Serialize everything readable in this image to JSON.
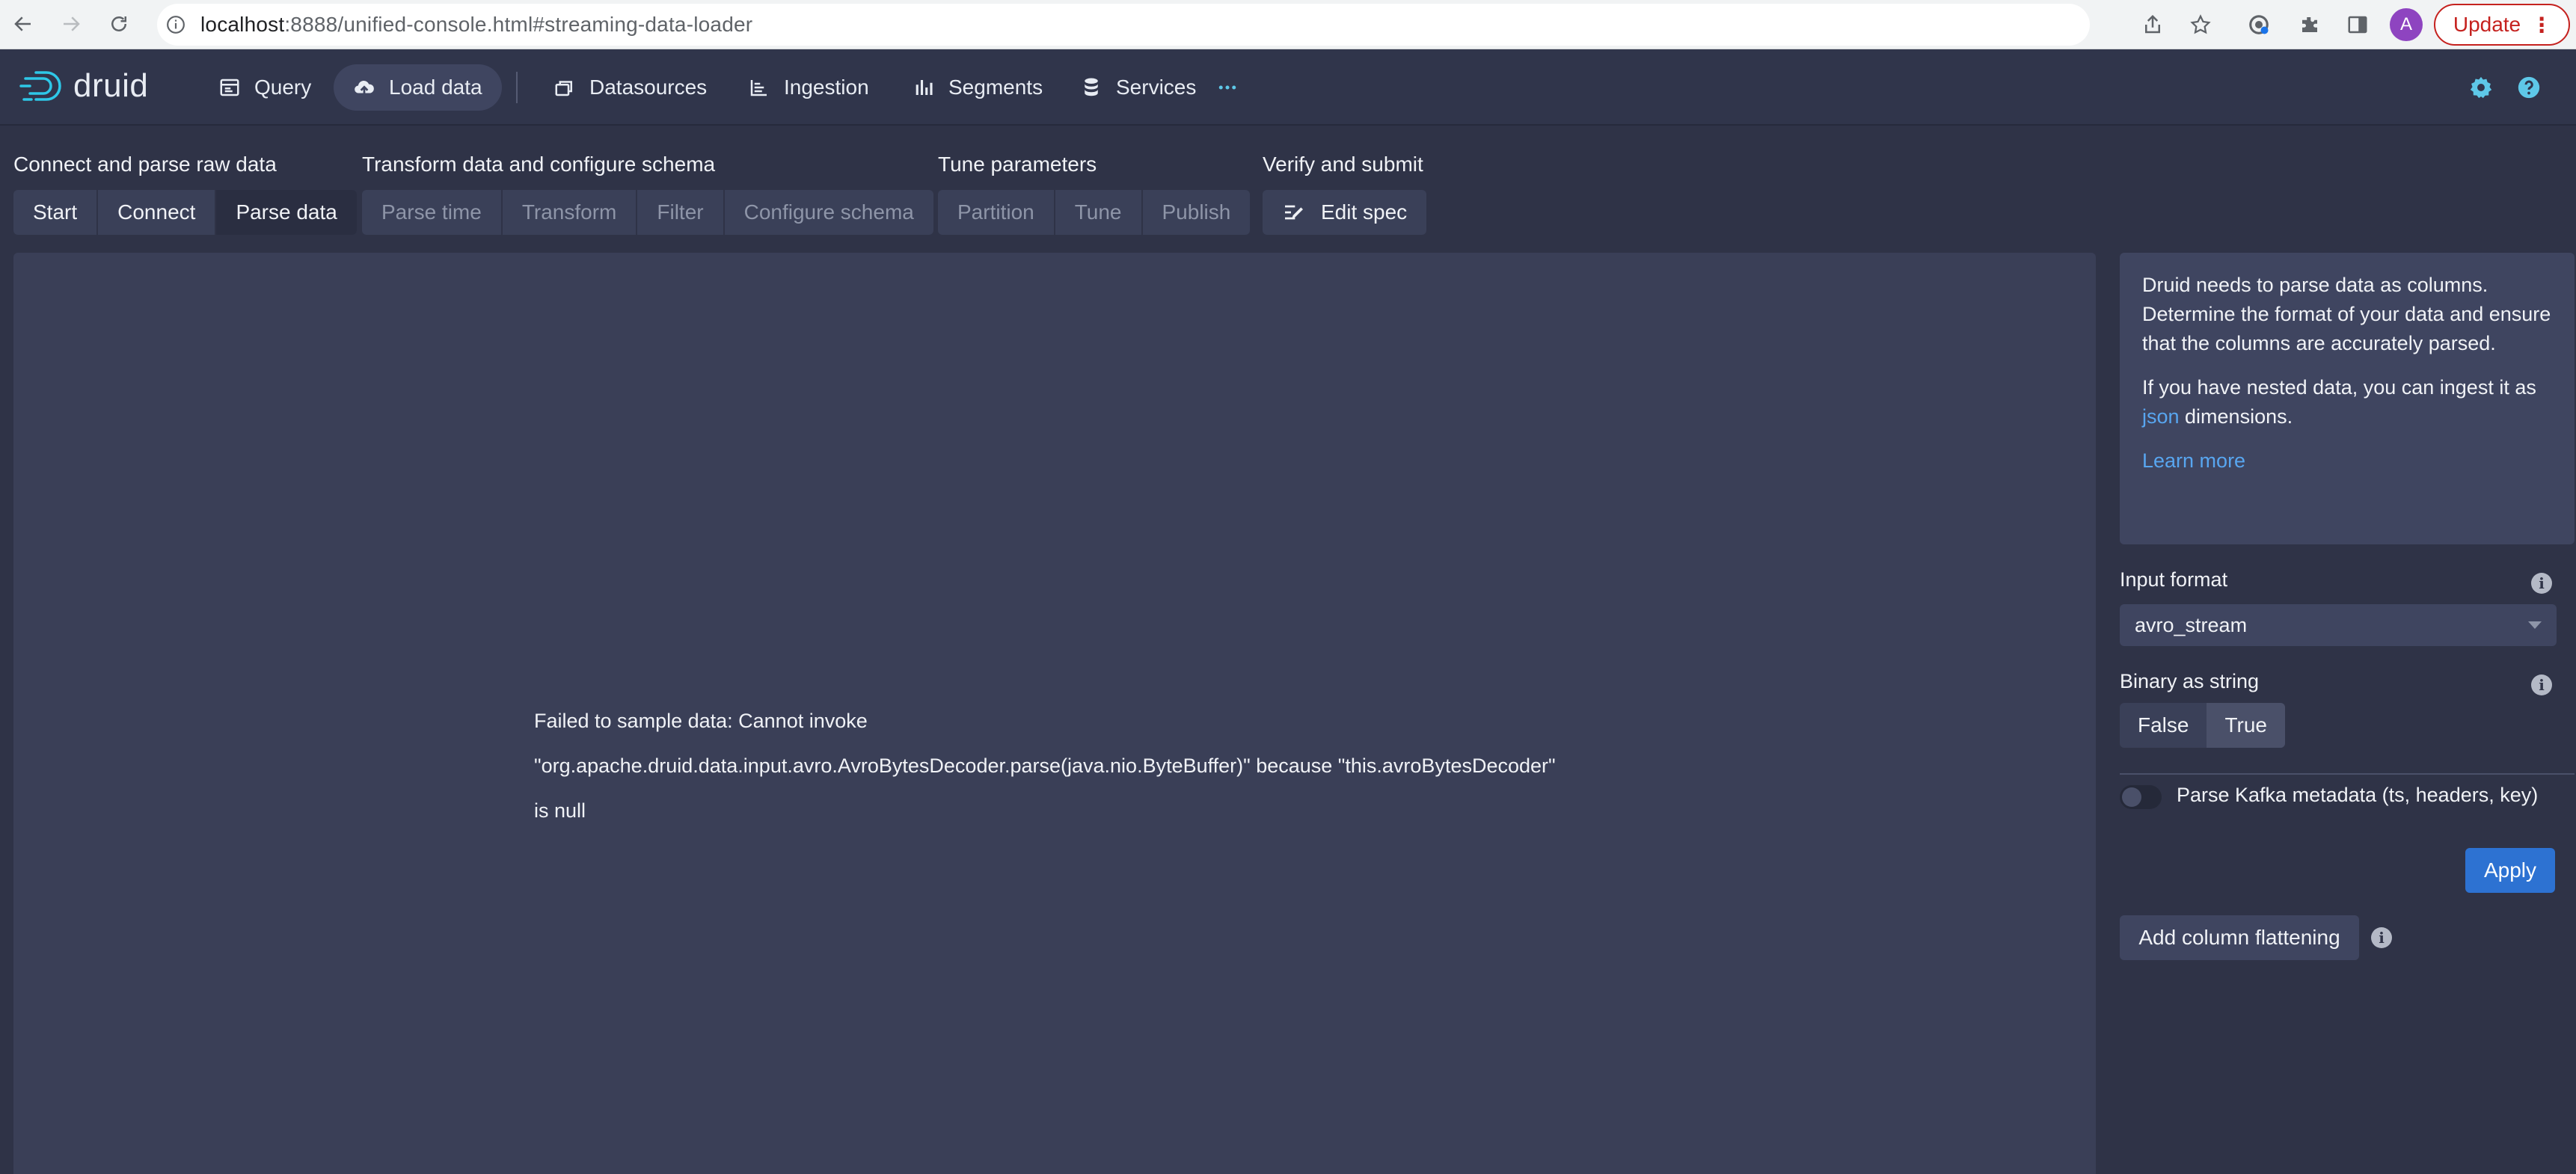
{
  "browser": {
    "url_host": "localhost",
    "url_rest": ":8888/unified-console.html#streaming-data-loader",
    "profile_initial": "A",
    "update_label": "Update"
  },
  "header": {
    "logo_text": "druid",
    "nav": [
      {
        "label": "Query",
        "icon": "query-icon"
      },
      {
        "label": "Load data",
        "icon": "cloud-upload-icon"
      },
      {
        "label": "Datasources",
        "icon": "datasources-icon"
      },
      {
        "label": "Ingestion",
        "icon": "ingestion-icon"
      },
      {
        "label": "Segments",
        "icon": "segments-icon"
      },
      {
        "label": "Services",
        "icon": "database-icon"
      }
    ],
    "more_icon": "ellipsis-icon",
    "settings_icon": "gear-icon",
    "help_icon": "help-icon"
  },
  "steps": {
    "groups": [
      {
        "title": "Connect and parse raw data",
        "buttons": [
          "Start",
          "Connect",
          "Parse data"
        ]
      },
      {
        "title": "Transform data and configure schema",
        "buttons": [
          "Parse time",
          "Transform",
          "Filter",
          "Configure schema"
        ]
      },
      {
        "title": "Tune parameters",
        "buttons": [
          "Partition",
          "Tune",
          "Publish"
        ]
      },
      {
        "title": "Verify and submit",
        "buttons": [
          "Edit spec"
        ]
      }
    ],
    "current": "Parse data"
  },
  "main": {
    "error_line1": "Failed to sample data: Cannot invoke",
    "error_line2": "\"org.apache.druid.data.input.avro.AvroBytesDecoder.parse(java.nio.ByteBuffer)\" because \"this.avroBytesDecoder\"",
    "error_line3": "is null"
  },
  "sidebar": {
    "info_p1": "Druid needs to parse data as columns. Determine the format of your data and ensure that the columns are accurately parsed.",
    "info_p2_before": "If you have nested data, you can ingest it as ",
    "info_p2_link": "json",
    "info_p2_after": " dimensions.",
    "learn_more": "Learn more",
    "input_format_label": "Input format",
    "input_format_value": "avro_stream",
    "binary_label": "Binary as string",
    "binary_options": [
      "False",
      "True"
    ],
    "binary_selected": "True",
    "kafka_meta_label": "Parse Kafka metadata (ts, headers, key)",
    "kafka_meta_enabled": false,
    "apply_label": "Apply",
    "flatten_label": "Add column flattening"
  }
}
